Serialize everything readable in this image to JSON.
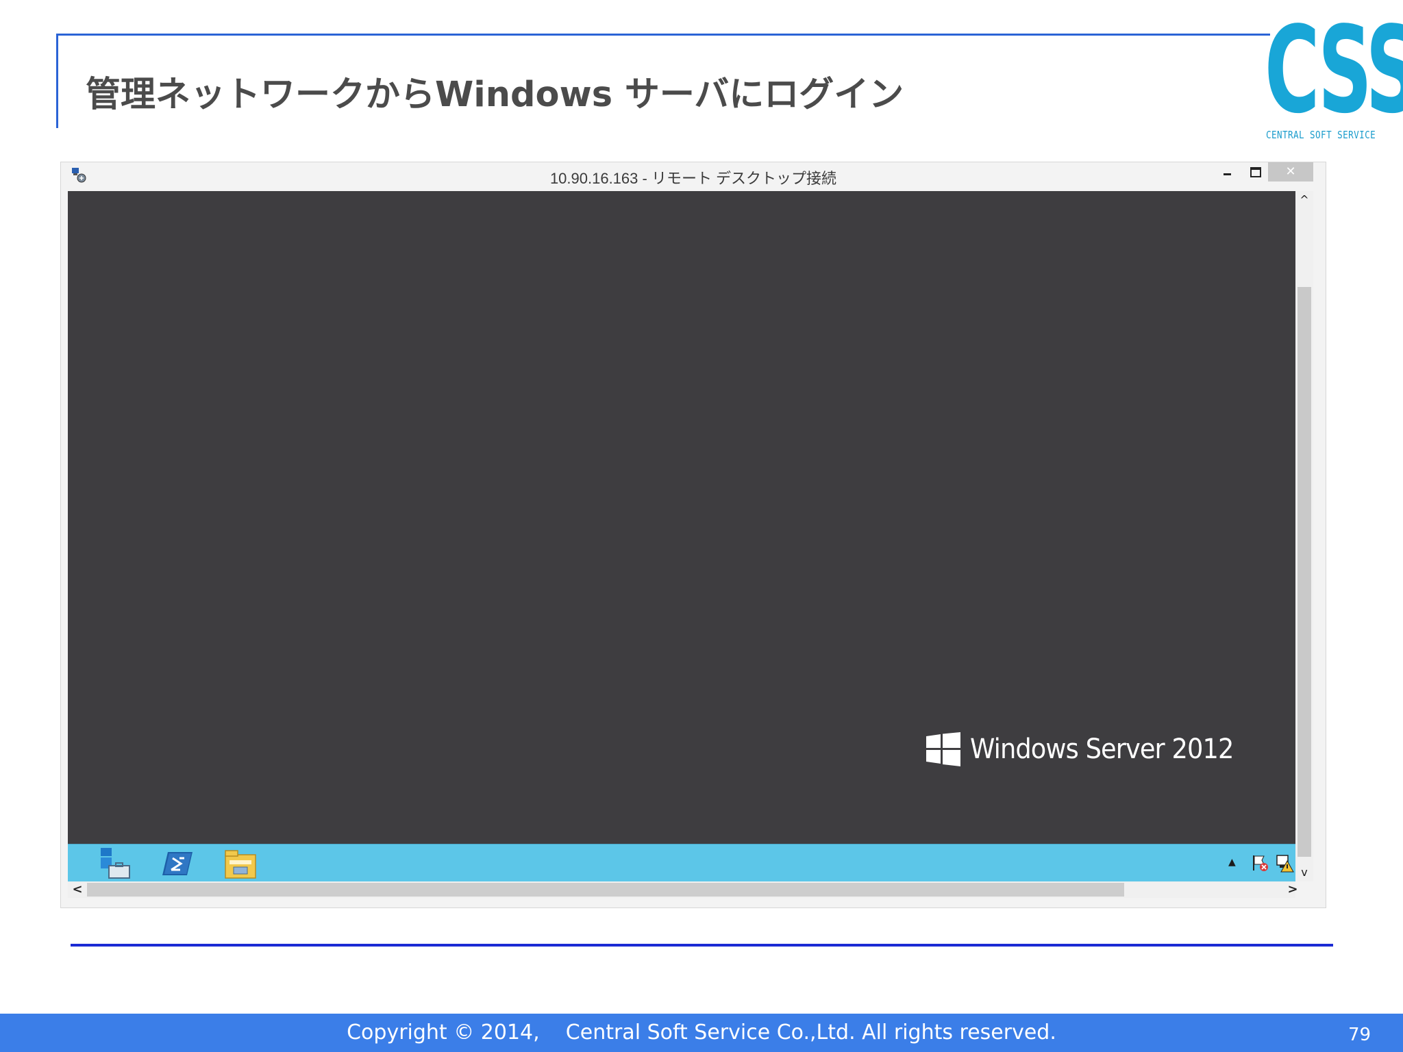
{
  "slide": {
    "title": "管理ネットワークからWindows サーバにログイン",
    "logo": {
      "mark": "CSS",
      "tagline": "CENTRAL SOFT SERVICE"
    },
    "footer": {
      "copyright": "Copyright © 2014,    Central Soft Service Co.,Ltd. All rights reserved.",
      "page_number": "79"
    }
  },
  "rdp_window": {
    "title": "10.90.16.163 - リモート デスクトップ接続",
    "buttons": {
      "minimize": "–",
      "maximize": "□",
      "close": "✕"
    },
    "brand": "Windows Server 2012",
    "taskbar": {
      "pinned": [
        "server-manager-icon",
        "powershell-icon",
        "file-explorer-icon"
      ],
      "tray": {
        "expand": "▲",
        "icons": [
          "action-center-flag-icon",
          "network-icon"
        ]
      }
    },
    "scrollbars": {
      "up": "^",
      "down": "v",
      "left": "<",
      "right": ">"
    }
  },
  "colors": {
    "accent_blue": "#2a63d6",
    "logo_cyan": "#19a6d7",
    "desktop_bg": "#3e3d40",
    "taskbar": "#5cc6e8",
    "footer_bar": "#3b7ee8"
  }
}
